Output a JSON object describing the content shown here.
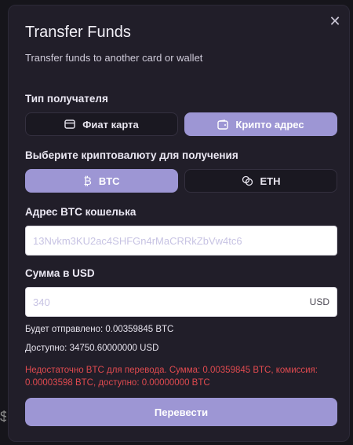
{
  "dialog": {
    "title": "Transfer Funds",
    "subtitle": "Transfer funds to another card or wallet",
    "close_icon": "close-icon"
  },
  "recipient_type": {
    "label": "Тип получателя",
    "options": [
      {
        "label": "Фиат карта",
        "icon": "card-icon",
        "selected": false
      },
      {
        "label": "Крипто адрес",
        "icon": "wallet-icon",
        "selected": true
      }
    ]
  },
  "currency": {
    "label": "Выберите криптовалюту для получения",
    "options": [
      {
        "label": "BTC",
        "icon": "bitcoin-icon",
        "selected": true
      },
      {
        "label": "ETH",
        "icon": "coins-icon",
        "selected": false
      }
    ]
  },
  "address": {
    "label": "Адрес BTC кошелька",
    "placeholder": "13Nvkm3KU2ac4SHFGn4rMaCRRkZbVw4tc6",
    "value": ""
  },
  "amount": {
    "label": "Сумма в USD",
    "placeholder": "340",
    "value": "",
    "suffix": "USD"
  },
  "summary": {
    "will_send": "Будет отправлено: 0.00359845 BTC",
    "available": "Доступно: 34750.60000000 USD"
  },
  "error_message": "Недостаточно BTC для перевода. Сумма: 0.00359845 BTC, комиссия: 0.00003598 BTC, доступно: 0.00000000 BTC",
  "submit_label": "Перевести",
  "colors": {
    "accent": "#9d96d4",
    "error": "#df4a4f",
    "dialog_bg": "#211e29"
  }
}
